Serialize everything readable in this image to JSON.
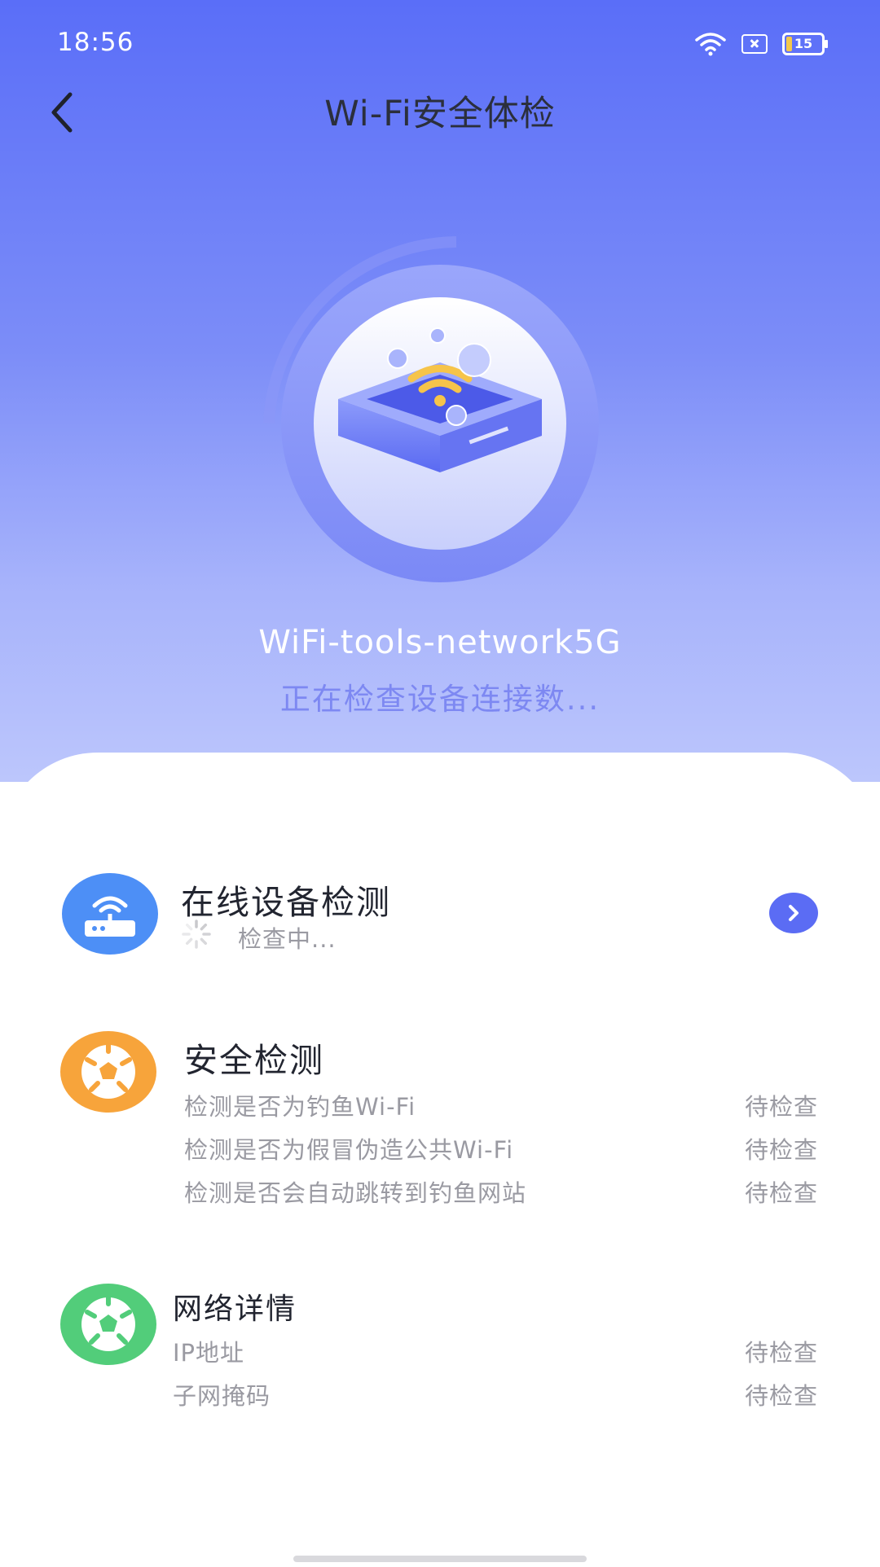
{
  "status_bar": {
    "time": "18:56",
    "battery": "15"
  },
  "header": {
    "title": "Wi-Fi安全体检"
  },
  "hero": {
    "ssid": "WiFi-tools-network5G",
    "status": "正在检查设备连接数..."
  },
  "online_devices": {
    "title": "在线设备检测",
    "status": "检查中..."
  },
  "security": {
    "title": "安全检测",
    "rows": [
      {
        "label": "检测是否为钓鱼Wi-Fi",
        "status": "待检查"
      },
      {
        "label": "检测是否为假冒伪造公共Wi-Fi",
        "status": "待检查"
      },
      {
        "label": "检测是否会自动跳转到钓鱼网站",
        "status": "待检查"
      }
    ]
  },
  "network": {
    "title": "网络详情",
    "rows": [
      {
        "label": "IP地址",
        "status": "待检查"
      },
      {
        "label": "子网掩码",
        "status": "待检查"
      }
    ]
  },
  "colors": {
    "accent": "#5b6cf4",
    "router_icon": "#4d8ff6",
    "security_icon": "#f7a43b",
    "network_icon": "#52cd7a"
  },
  "icons": [
    "wifi-icon",
    "sim-icon",
    "battery-icon",
    "back-arrow-icon",
    "router-icon",
    "ball-icon",
    "chevron-right-icon",
    "spinner-icon"
  ]
}
